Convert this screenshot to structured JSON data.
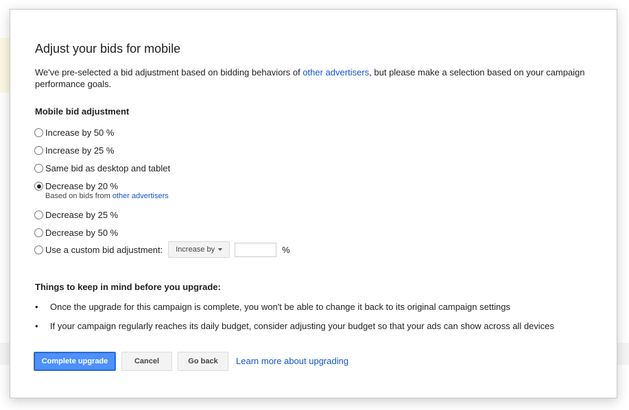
{
  "dialog": {
    "title": "Adjust your bids for mobile",
    "intro_before": "We've pre-selected a bid adjustment based on bidding behaviors of ",
    "intro_link": "other advertisers",
    "intro_after": ", but please make a selection based on your campaign performance goals.",
    "section_title": "Mobile bid adjustment",
    "options": [
      {
        "label": "Increase by 50 %",
        "selected": false
      },
      {
        "label": "Increase by 25 %",
        "selected": false
      },
      {
        "label": "Same bid as desktop and tablet",
        "selected": false
      },
      {
        "label": "Decrease by 20 %",
        "selected": true
      },
      {
        "label": "Decrease by 25 %",
        "selected": false
      },
      {
        "label": "Decrease by 50 %",
        "selected": false
      },
      {
        "label": "Use a custom bid adjustment:",
        "selected": false
      }
    ],
    "recommended_note": "Based on bids from ",
    "recommended_link": "other advertisers",
    "custom": {
      "dropdown_value": "Increase by",
      "input_value": "",
      "unit": "%"
    },
    "keep_in_mind_title": "Things to keep in mind before you upgrade:",
    "bullets": [
      "Once the upgrade for this campaign is complete, you won't be able to change it back to its original campaign settings",
      "If your campaign regularly reaches its daily budget, consider adjusting your budget so that your ads can show across all devices"
    ],
    "buttons": {
      "complete": "Complete upgrade",
      "cancel": "Cancel",
      "go_back": "Go back"
    },
    "learn_more": "Learn more about upgrading"
  },
  "colors": {
    "primary": "#4d90fe",
    "link": "#1155cc"
  }
}
